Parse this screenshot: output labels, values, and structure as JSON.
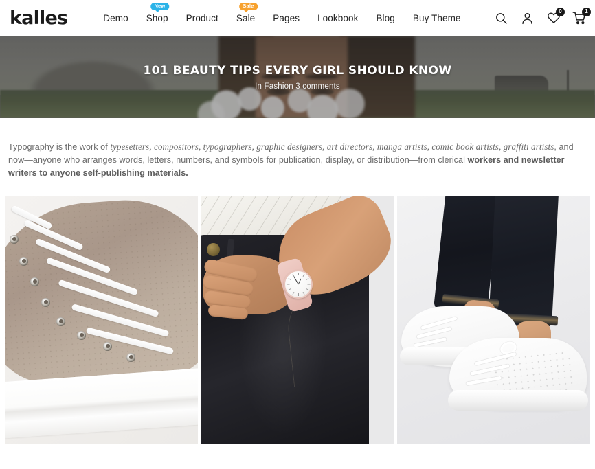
{
  "header": {
    "logo": "kalles",
    "nav": [
      {
        "label": "Demo",
        "badge": null
      },
      {
        "label": "Shop",
        "badge": "New",
        "badge_color": "#2bb3e8"
      },
      {
        "label": "Product",
        "badge": null
      },
      {
        "label": "Sale",
        "badge": "Sale",
        "badge_color": "#f7a12e"
      },
      {
        "label": "Pages",
        "badge": null
      },
      {
        "label": "Lookbook",
        "badge": null
      },
      {
        "label": "Blog",
        "badge": null
      },
      {
        "label": "Buy Theme",
        "badge": null
      }
    ],
    "icons": {
      "search": "search-icon",
      "account": "user-icon",
      "wishlist": "heart-icon",
      "wishlist_count": "0",
      "cart": "cart-icon",
      "cart_count": "1"
    }
  },
  "hero": {
    "title": "101 BEAUTY TIPS EVERY GIRL SHOULD KNOW",
    "meta_prefix": "In",
    "meta_category": "Fashion",
    "meta_comments": "3 comments"
  },
  "article": {
    "p1_a": "Typography is the work of ",
    "p1_italic": "typesetters, compositors, typographers, graphic designers, art directors, manga artists, comic book artists, graffiti artists",
    "p1_b": ", and now—anyone who arranges words, letters, numbers, and symbols for publication, display, or distribution—from clerical ",
    "p1_bold": "workers and newsletter writers to anyone self-publishing materials."
  },
  "gallery": {
    "items": [
      {
        "name": "beige-hightop-sneaker",
        "alt": "Beige perforated high-top sneaker with white laces and white platform sole"
      },
      {
        "name": "pink-watch-black-jeans",
        "alt": "Hand with pink strap wristwatch resting against black jeans and white top"
      },
      {
        "name": "white-sneakers-dark-jeans",
        "alt": "White low-top sneakers worn with dark indigo cuffed jeans"
      }
    ]
  },
  "colors": {
    "accent_new": "#2bb3e8",
    "accent_sale": "#f7a12e",
    "text": "#222222",
    "body_text": "#6b6b6b",
    "badge_bg": "#181818"
  }
}
